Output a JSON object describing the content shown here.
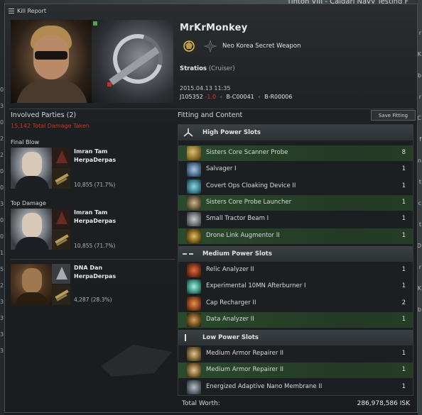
{
  "background": {
    "top_text": "Tintoh VIII - Caldari Navy Testing F",
    "left_marks": [
      "0",
      "3",
      "0",
      "2",
      "2",
      "0",
      "0",
      "3",
      "0",
      "0",
      "1",
      "5",
      "2",
      "3",
      "3",
      "3",
      "3"
    ],
    "right_marks": [
      "r",
      "K",
      "b",
      "r",
      "C",
      "f",
      "n",
      "t",
      "c",
      "t",
      "D",
      "r",
      "K",
      "b"
    ]
  },
  "window": {
    "title": "Kill Report"
  },
  "victim": {
    "name": "MrKrMonkey",
    "corporation": "Neo Korea Secret Weapon",
    "ship_name": "Stratios",
    "ship_class": "(Cruiser)",
    "date": "2015.04.13 11:35",
    "system": "J105352",
    "security": "-1.0",
    "constellation": "B-C00041",
    "region": "B-R00006"
  },
  "involved": {
    "header": "Involved Parties (2)",
    "damage_taken": "15,142 Total Damage Taken",
    "final_blow_label": "Final Blow",
    "top_damage_label": "Top Damage",
    "attackers": [
      {
        "name": "Imran Tam",
        "corp": "HerpaDerpas",
        "damage": "10,855 (71.7%)"
      },
      {
        "name": "Imran Tam",
        "corp": "HerpaDerpas",
        "damage": "10,855 (71.7%)"
      },
      {
        "name": "DNA Dan",
        "corp": "HerpaDerpas",
        "damage": "4,287 (28.3%)"
      }
    ]
  },
  "fitting": {
    "header": "Fitting and Content",
    "save_label": "Save Fitting",
    "sections": [
      {
        "title": "High Power Slots",
        "icon": "high-slot-icon",
        "modules": [
          {
            "name": "Sisters Core Scanner Probe",
            "qty": "8",
            "highlight": true,
            "icon": "probe-icon"
          },
          {
            "name": "Salvager I",
            "qty": "1",
            "highlight": false,
            "icon": "salvager-icon"
          },
          {
            "name": "Covert Ops Cloaking Device II",
            "qty": "1",
            "highlight": false,
            "icon": "cloak-icon"
          },
          {
            "name": "Sisters Core Probe Launcher",
            "qty": "1",
            "highlight": true,
            "icon": "launcher-icon"
          },
          {
            "name": "Small Tractor Beam I",
            "qty": "1",
            "highlight": false,
            "icon": "tractor-icon"
          },
          {
            "name": "Drone Link Augmentor II",
            "qty": "1",
            "highlight": true,
            "icon": "drone-link-icon"
          }
        ]
      },
      {
        "title": "Medium Power Slots",
        "icon": "medium-slot-icon",
        "modules": [
          {
            "name": "Relic Analyzer II",
            "qty": "1",
            "highlight": false,
            "icon": "relic-analyzer-icon"
          },
          {
            "name": "Experimental 10MN Afterburner I",
            "qty": "1",
            "highlight": false,
            "icon": "afterburner-icon"
          },
          {
            "name": "Cap Recharger II",
            "qty": "2",
            "highlight": false,
            "icon": "cap-recharger-icon"
          },
          {
            "name": "Data Analyzer II",
            "qty": "1",
            "highlight": true,
            "icon": "data-analyzer-icon"
          }
        ]
      },
      {
        "title": "Low Power Slots",
        "icon": "low-slot-icon",
        "modules": [
          {
            "name": "Medium Armor Repairer II",
            "qty": "1",
            "highlight": false,
            "icon": "armor-repairer-icon"
          },
          {
            "name": "Medium Armor Repairer II",
            "qty": "1",
            "highlight": true,
            "icon": "armor-repairer-icon"
          },
          {
            "name": "Energized Adaptive Nano Membrane II",
            "qty": "1",
            "highlight": false,
            "icon": "membrane-icon"
          }
        ]
      }
    ]
  },
  "total": {
    "label": "Total Worth:",
    "value": "286,978,586 ISK"
  },
  "colors": {
    "highlight_row": "#2a4a2c",
    "security_red": "#e0302a",
    "damage_red": "#d03020"
  }
}
